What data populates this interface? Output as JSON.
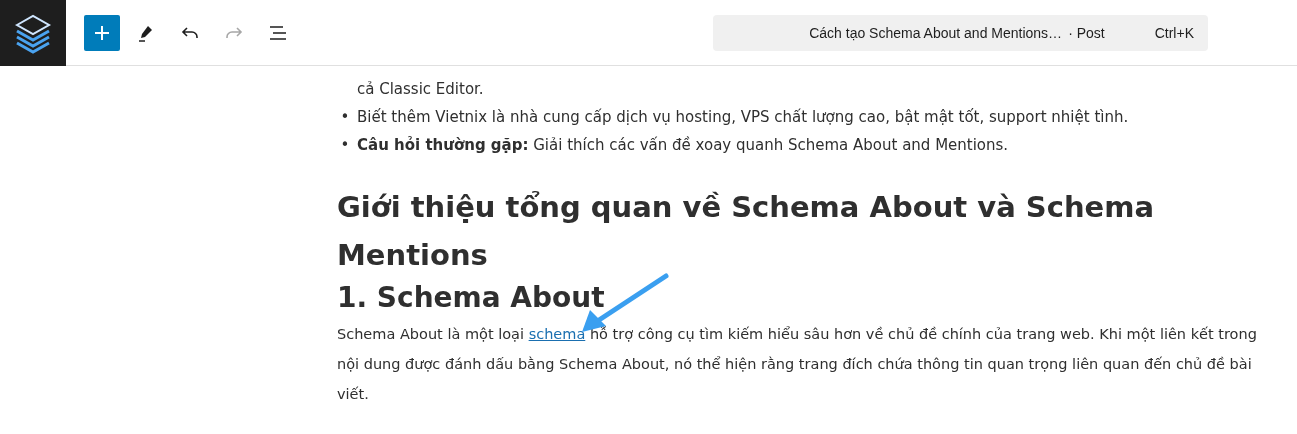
{
  "toolbar": {
    "buttons": [
      {
        "kind": "add",
        "selected": true,
        "disabled": false
      },
      {
        "kind": "edit",
        "selected": false,
        "disabled": false
      },
      {
        "kind": "undo",
        "selected": false,
        "disabled": false
      },
      {
        "kind": "redo",
        "selected": false,
        "disabled": true
      },
      {
        "kind": "list",
        "selected": false,
        "disabled": false
      }
    ],
    "command_bar": {
      "title": "Cách tạo Schema About and Mentions…",
      "type": "· Post",
      "shortcut": "Ctrl+K"
    }
  },
  "content": {
    "list": [
      {
        "kind": "continuation",
        "text": "cả Classic Editor."
      },
      {
        "kind": "bullet",
        "marker": "•",
        "text": "Biết thêm Vietnix là nhà cung cấp dịch vụ hosting, VPS chất lượng cao, bật mật tốt, support nhiệt tình."
      },
      {
        "kind": "bullet",
        "marker": "•",
        "text": "**Câu hỏi thường gặp:** Giải thích các vấn đề xoay quanh Schema About and Mentions."
      }
    ],
    "heading": "Giới thiệu tổng quan về Schema About và Schema Mentions",
    "subheading": "1. Schema About",
    "paragraph": {
      "before": "Schema About là một loại ",
      "link": "schema",
      "after": " hỗ trợ công cụ tìm kiếm hiểu sâu hơn về chủ đề chính của trang web. Khi một liên kết trong nội dung được đánh dấu bằng Schema About, nó thể hiện rằng trang đích chứa thông tin quan trọng liên quan đến chủ đề bài viết."
    }
  }
}
